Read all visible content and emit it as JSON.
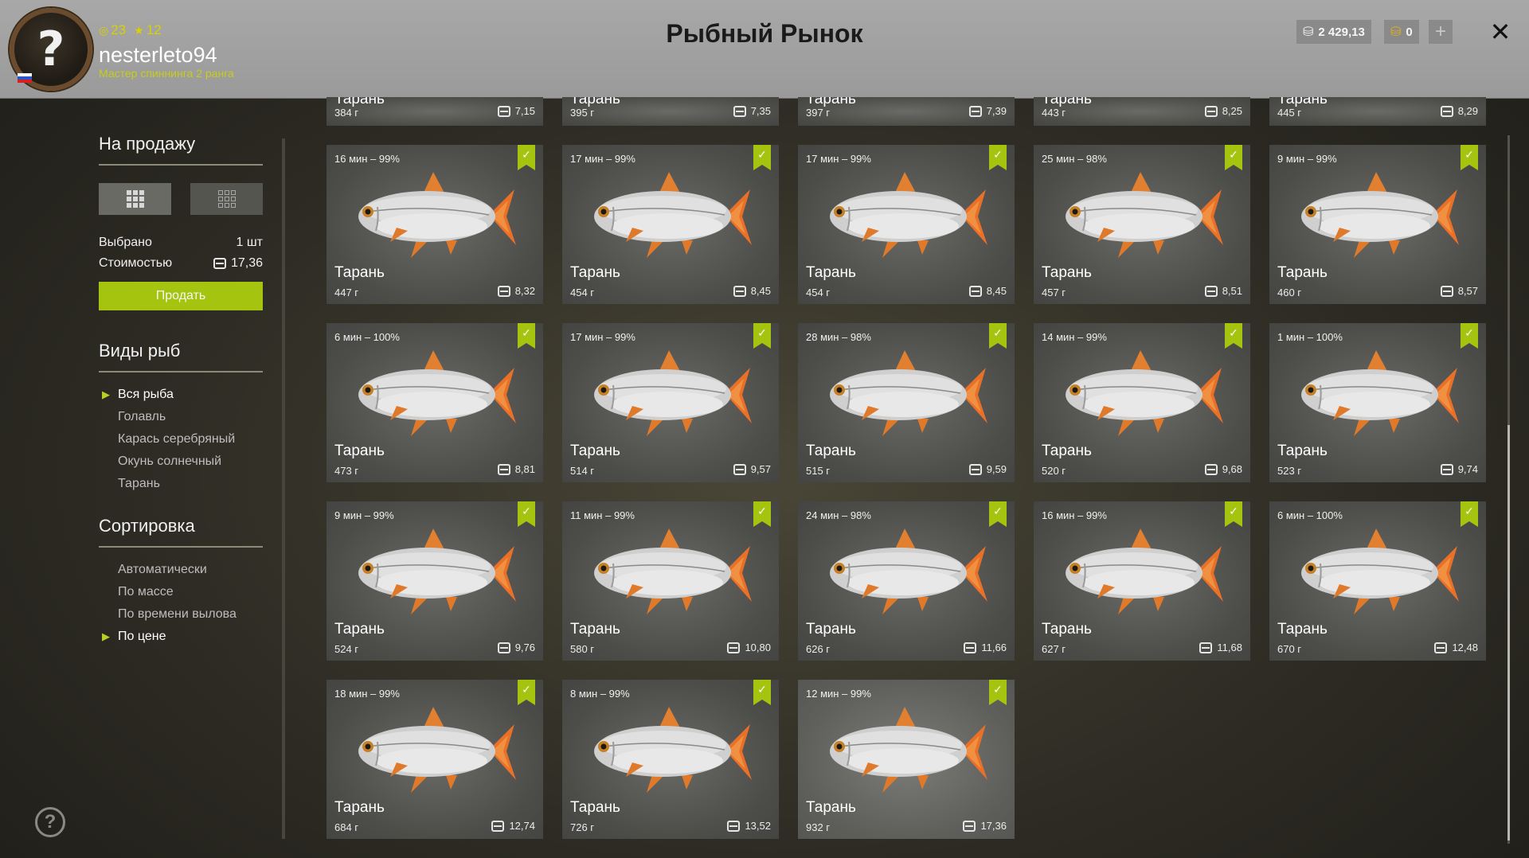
{
  "player": {
    "level": "23",
    "stars": "12",
    "username": "nesterleto94",
    "rank": "Мастер спиннинга 2 ранга"
  },
  "header": {
    "title": "Рыбный Рынок",
    "silver": "2 429,13",
    "gold": "0"
  },
  "sale": {
    "title": "На продажу",
    "selected_label": "Выбрано",
    "selected_value": "1 шт",
    "cost_label": "Стоимостью",
    "cost_value": "17,36",
    "sell_button": "Продать"
  },
  "species": {
    "title": "Виды рыб",
    "items": [
      "Вся рыба",
      "Голавль",
      "Карась серебряный",
      "Окунь солнечный",
      "Тарань"
    ],
    "active": 0
  },
  "sort": {
    "title": "Сортировка",
    "items": [
      "Автоматически",
      "По массе",
      "По времени вылова",
      "По цене"
    ],
    "active": 3
  },
  "colors": {
    "accent": "#a5c40f",
    "header_bg": "#a0a0a0"
  },
  "partial_cards": [
    {
      "name": "Тарань",
      "weight": "384 г",
      "price": "7,15"
    },
    {
      "name": "Тарань",
      "weight": "395 г",
      "price": "7,35"
    },
    {
      "name": "Тарань",
      "weight": "397 г",
      "price": "7,39"
    },
    {
      "name": "Тарань",
      "weight": "443 г",
      "price": "8,25"
    },
    {
      "name": "Тарань",
      "weight": "445 г",
      "price": "8,29"
    }
  ],
  "cards": [
    {
      "time": "16 мин – 99%",
      "name": "Тарань",
      "weight": "447 г",
      "price": "8,32"
    },
    {
      "time": "17 мин – 99%",
      "name": "Тарань",
      "weight": "454 г",
      "price": "8,45"
    },
    {
      "time": "17 мин – 99%",
      "name": "Тарань",
      "weight": "454 г",
      "price": "8,45"
    },
    {
      "time": "25 мин – 98%",
      "name": "Тарань",
      "weight": "457 г",
      "price": "8,51"
    },
    {
      "time": "9 мин – 99%",
      "name": "Тарань",
      "weight": "460 г",
      "price": "8,57"
    },
    {
      "time": "6 мин – 100%",
      "name": "Тарань",
      "weight": "473 г",
      "price": "8,81"
    },
    {
      "time": "17 мин – 99%",
      "name": "Тарань",
      "weight": "514 г",
      "price": "9,57"
    },
    {
      "time": "28 мин – 98%",
      "name": "Тарань",
      "weight": "515 г",
      "price": "9,59"
    },
    {
      "time": "14 мин – 99%",
      "name": "Тарань",
      "weight": "520 г",
      "price": "9,68"
    },
    {
      "time": "1 мин – 100%",
      "name": "Тарань",
      "weight": "523 г",
      "price": "9,74"
    },
    {
      "time": "9 мин – 99%",
      "name": "Тарань",
      "weight": "524 г",
      "price": "9,76"
    },
    {
      "time": "11 мин – 99%",
      "name": "Тарань",
      "weight": "580 г",
      "price": "10,80"
    },
    {
      "time": "24 мин – 98%",
      "name": "Тарань",
      "weight": "626 г",
      "price": "11,66"
    },
    {
      "time": "16 мин – 99%",
      "name": "Тарань",
      "weight": "627 г",
      "price": "11,68"
    },
    {
      "time": "6 мин – 100%",
      "name": "Тарань",
      "weight": "670 г",
      "price": "12,48"
    },
    {
      "time": "18 мин – 99%",
      "name": "Тарань",
      "weight": "684 г",
      "price": "12,74"
    },
    {
      "time": "8 мин – 99%",
      "name": "Тарань",
      "weight": "726 г",
      "price": "13,52"
    },
    {
      "time": "12 мин – 99%",
      "name": "Тарань",
      "weight": "932 г",
      "price": "17,36",
      "selected": true
    }
  ]
}
